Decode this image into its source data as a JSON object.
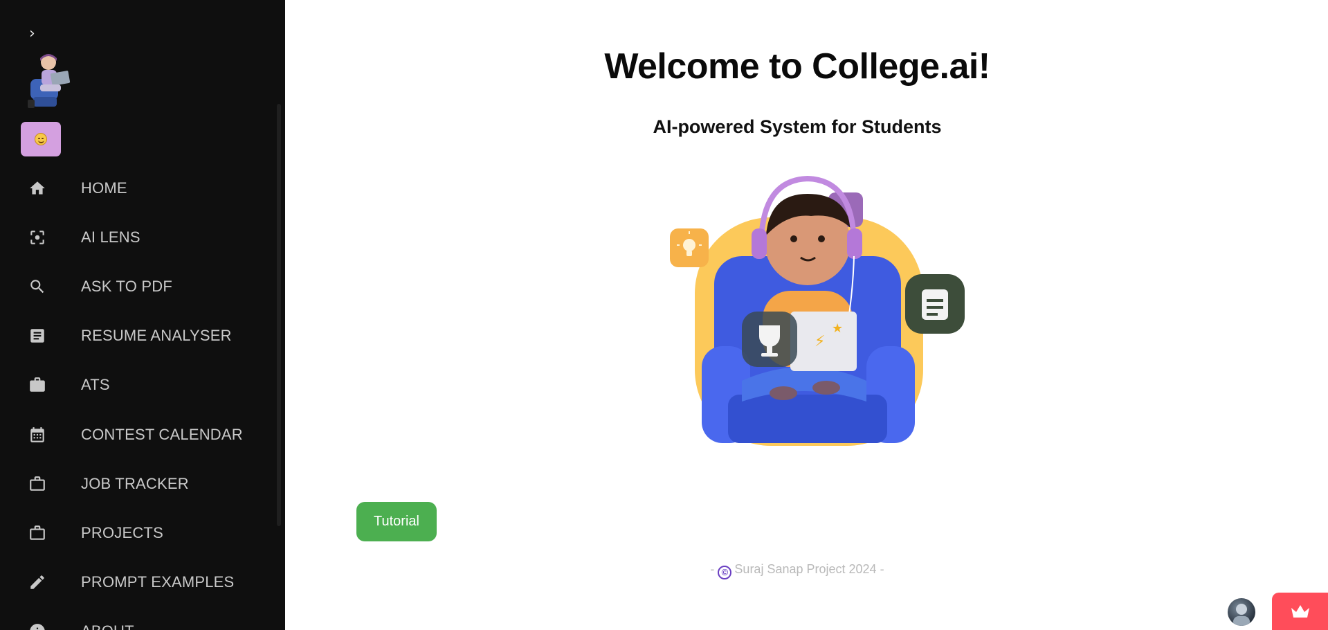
{
  "sidebar": {
    "collapse_icon": "chevron-right-icon",
    "items": [
      {
        "label": "HOME",
        "icon": "home-icon"
      },
      {
        "label": "AI LENS",
        "icon": "center-focus-icon"
      },
      {
        "label": "ASK TO PDF",
        "icon": "search-icon"
      },
      {
        "label": "RESUME ANALYSER",
        "icon": "article-icon"
      },
      {
        "label": "ATS",
        "icon": "briefcase-icon"
      },
      {
        "label": "CONTEST CALENDAR",
        "icon": "calendar-icon"
      },
      {
        "label": "JOB TRACKER",
        "icon": "work-outline-icon"
      },
      {
        "label": "PROJECTS",
        "icon": "work-outline-icon"
      },
      {
        "label": "PROMPT EXAMPLES",
        "icon": "pencil-icon"
      },
      {
        "label": "ABOUT",
        "icon": "info-icon"
      }
    ]
  },
  "main": {
    "title": "Welcome to College.ai!",
    "subtitle": "AI-powered System for Students",
    "tutorial_label": "Tutorial",
    "footer_prefix": "-",
    "footer_text": "Suraj Sanap Project 2024",
    "footer_suffix": "-",
    "copyright_symbol": "©"
  },
  "colors": {
    "sidebar_bg": "#0f0f0f",
    "nav_text": "#c9c9c9",
    "emoji_chip": "#d4a0e0",
    "tutorial_button": "#4caf50",
    "crown_button": "#ff4d5a",
    "footer_text": "#b9b9b9"
  }
}
